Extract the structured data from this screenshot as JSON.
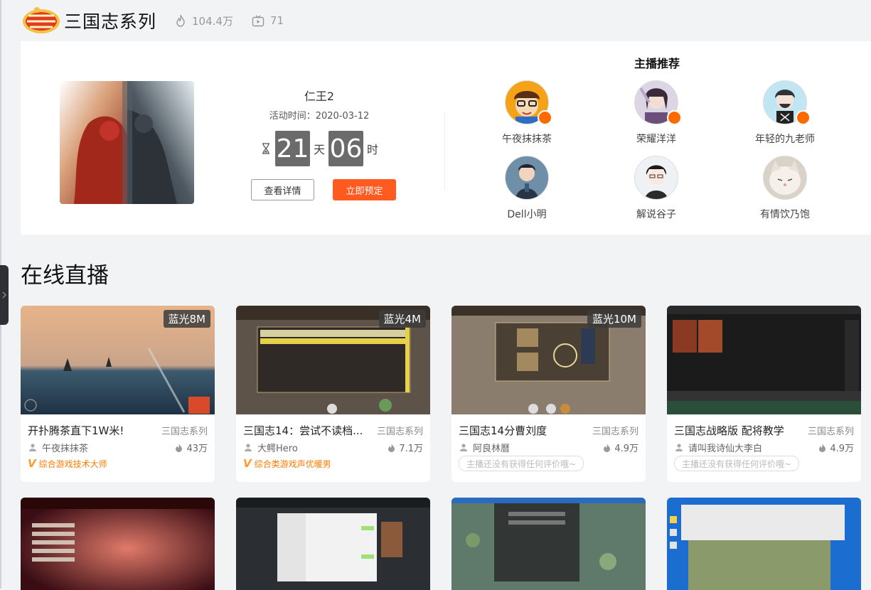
{
  "header": {
    "logo_text": "三国志",
    "title": "三国志系列",
    "heat": "104.4万",
    "live_count": "71"
  },
  "event": {
    "name": "仁王2",
    "time": "活动时间：2020-03-12",
    "days": "21",
    "day_unit": "天",
    "hours": "06",
    "hour_unit": "时",
    "detail_btn": "查看详情",
    "book_btn": "立即预定"
  },
  "recommend": {
    "title": "主播推荐",
    "streamers": [
      {
        "name": "午夜抹抹茶",
        "live": true
      },
      {
        "name": "荣耀洋洋",
        "live": true
      },
      {
        "name": "年轻的九老师",
        "live": true
      },
      {
        "name": "Dell小明",
        "live": false
      },
      {
        "name": "解说谷子",
        "live": false
      },
      {
        "name": "有情饮乃饱",
        "live": false
      }
    ]
  },
  "live_section": {
    "title": "在线直播",
    "cards": [
      {
        "quality": "蓝光8M",
        "title": "开扑腾茶直下1W米!",
        "category": "三国志系列",
        "user": "午夜抹抹茶",
        "heat": "43万",
        "tag": "综合游戏技术大师",
        "review": ""
      },
      {
        "quality": "蓝光4M",
        "title": "三国志14：尝试不读档...",
        "category": "三国志系列",
        "user": "大鳄Hero",
        "heat": "7.1万",
        "tag": "综合类游戏声优暖男",
        "review": ""
      },
      {
        "quality": "蓝光10M",
        "title": "三国志14分曹刘度",
        "category": "三国志系列",
        "user": "阿良林曆",
        "heat": "4.9万",
        "tag": "",
        "review": "主播还没有获得任何评价哦~"
      },
      {
        "quality": "",
        "title": "三国志战略版 配将教学",
        "category": "三国志系列",
        "user": "请叫我诗仙大李白",
        "heat": "4.9万",
        "tag": "",
        "review": "主播还没有获得任何评价哦~"
      }
    ]
  },
  "colors": {
    "accent": "#ff5a1f",
    "live_badge": "#ff6a00",
    "tag": "#ff7a00"
  }
}
